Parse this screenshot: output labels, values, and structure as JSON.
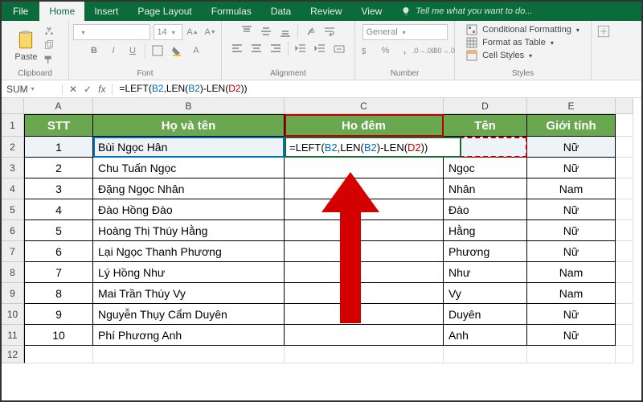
{
  "tabs": {
    "file": "File",
    "home": "Home",
    "insert": "Insert",
    "pagelayout": "Page Layout",
    "formulas": "Formulas",
    "data": "Data",
    "review": "Review",
    "view": "View",
    "tell": "Tell me what you want to do..."
  },
  "ribbon": {
    "clipboard": {
      "label": "Clipboard",
      "paste": "Paste"
    },
    "font": {
      "label": "Font",
      "name_ph": "",
      "size_ph": "14"
    },
    "alignment": {
      "label": "Alignment"
    },
    "number": {
      "label": "Number",
      "general": "General"
    },
    "styles": {
      "label": "Styles",
      "cond": "Conditional Formatting",
      "table": "Format as Table",
      "cell": "Cell Styles"
    }
  },
  "fx": {
    "namebox": "SUM",
    "formula_prefix": "=LEFT(",
    "formula_b2": "B2",
    "formula_mid1": ",LEN(",
    "formula_b2b": "B2",
    "formula_mid2": ")-LEN(",
    "formula_d2": "D2",
    "formula_suffix": "))"
  },
  "columns": [
    "A",
    "B",
    "C",
    "D",
    "E"
  ],
  "row_nums": [
    "1",
    "2",
    "3",
    "4",
    "5",
    "6",
    "7",
    "8",
    "9",
    "10",
    "11",
    "12"
  ],
  "headers": {
    "A": "STT",
    "B": "Họ và tên",
    "C": "Ho đêm",
    "D": "Tên",
    "E": "Giới tính"
  },
  "data": [
    {
      "stt": "1",
      "name": "Bùi Ngọc Hân",
      "d": "",
      "e": "Nữ"
    },
    {
      "stt": "2",
      "name": "Chu Tuấn Ngọc",
      "d": "Ngọc",
      "e": "Nữ"
    },
    {
      "stt": "3",
      "name": "Đặng Ngọc Nhân",
      "d": "Nhân",
      "e": "Nam"
    },
    {
      "stt": "4",
      "name": "Đào Hồng Đào",
      "d": "Đào",
      "e": "Nữ"
    },
    {
      "stt": "5",
      "name": "Hoàng Thị Thúy Hằng",
      "d": "Hằng",
      "e": "Nữ"
    },
    {
      "stt": "6",
      "name": "Lại Ngọc Thanh Phương",
      "d": "Phương",
      "e": "Nữ"
    },
    {
      "stt": "7",
      "name": "Lý Hồng Như",
      "d": "Như",
      "e": "Nam"
    },
    {
      "stt": "8",
      "name": "Mai Trần Thúy Vy",
      "d": "Vy",
      "e": "Nam"
    },
    {
      "stt": "9",
      "name": "Nguyễn Thụy Cẩm Duyên",
      "d": "Duyên",
      "e": "Nữ"
    },
    {
      "stt": "10",
      "name": "Phí Phương Anh",
      "d": "Anh",
      "e": "Nữ"
    }
  ]
}
